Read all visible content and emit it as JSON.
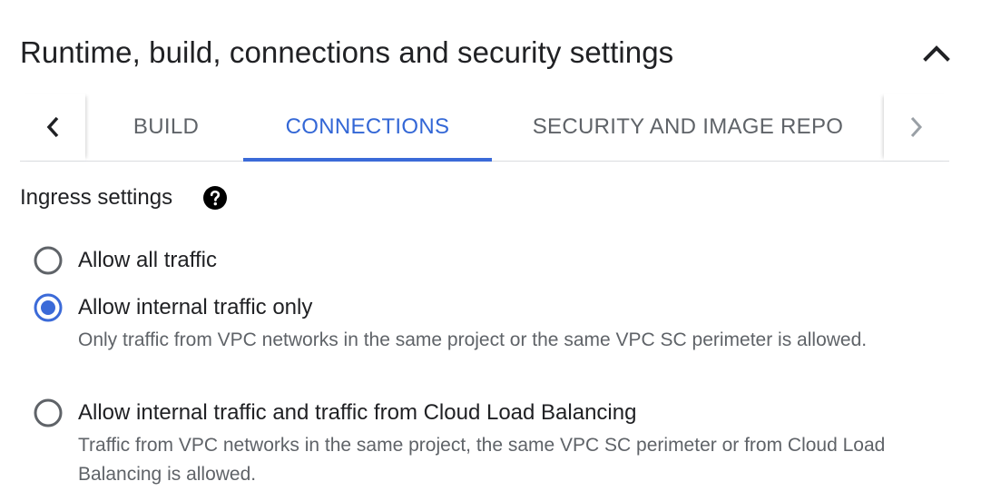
{
  "section": {
    "title": "Runtime, build, connections and security settings",
    "toggle_icon": "chevron-up-icon"
  },
  "tabs": {
    "items": [
      {
        "label": "BUILD",
        "active": false
      },
      {
        "label": "CONNECTIONS",
        "active": true
      },
      {
        "label": "SECURITY AND IMAGE REPO",
        "active": false
      }
    ],
    "prev_icon": "chevron-left-icon",
    "next_icon": "chevron-right-icon"
  },
  "ingress": {
    "label": "Ingress settings",
    "help_icon": "help-icon",
    "options": [
      {
        "label": "Allow all traffic",
        "description": "",
        "selected": false
      },
      {
        "label": "Allow internal traffic only",
        "description": "Only traffic from VPC networks in the same project or the same VPC SC perimeter is allowed.",
        "selected": true
      },
      {
        "label": "Allow internal traffic and traffic from Cloud Load Balancing",
        "description": "Traffic from VPC networks in the same project, the same VPC SC perimeter or from Cloud Load Balancing is allowed.",
        "selected": false
      }
    ]
  },
  "colors": {
    "accent": "#3b6ad8",
    "active_tab_text": "#3367d6",
    "text_primary": "#202124",
    "text_secondary": "#5f6368",
    "radio_unselected": "#5f6368"
  }
}
